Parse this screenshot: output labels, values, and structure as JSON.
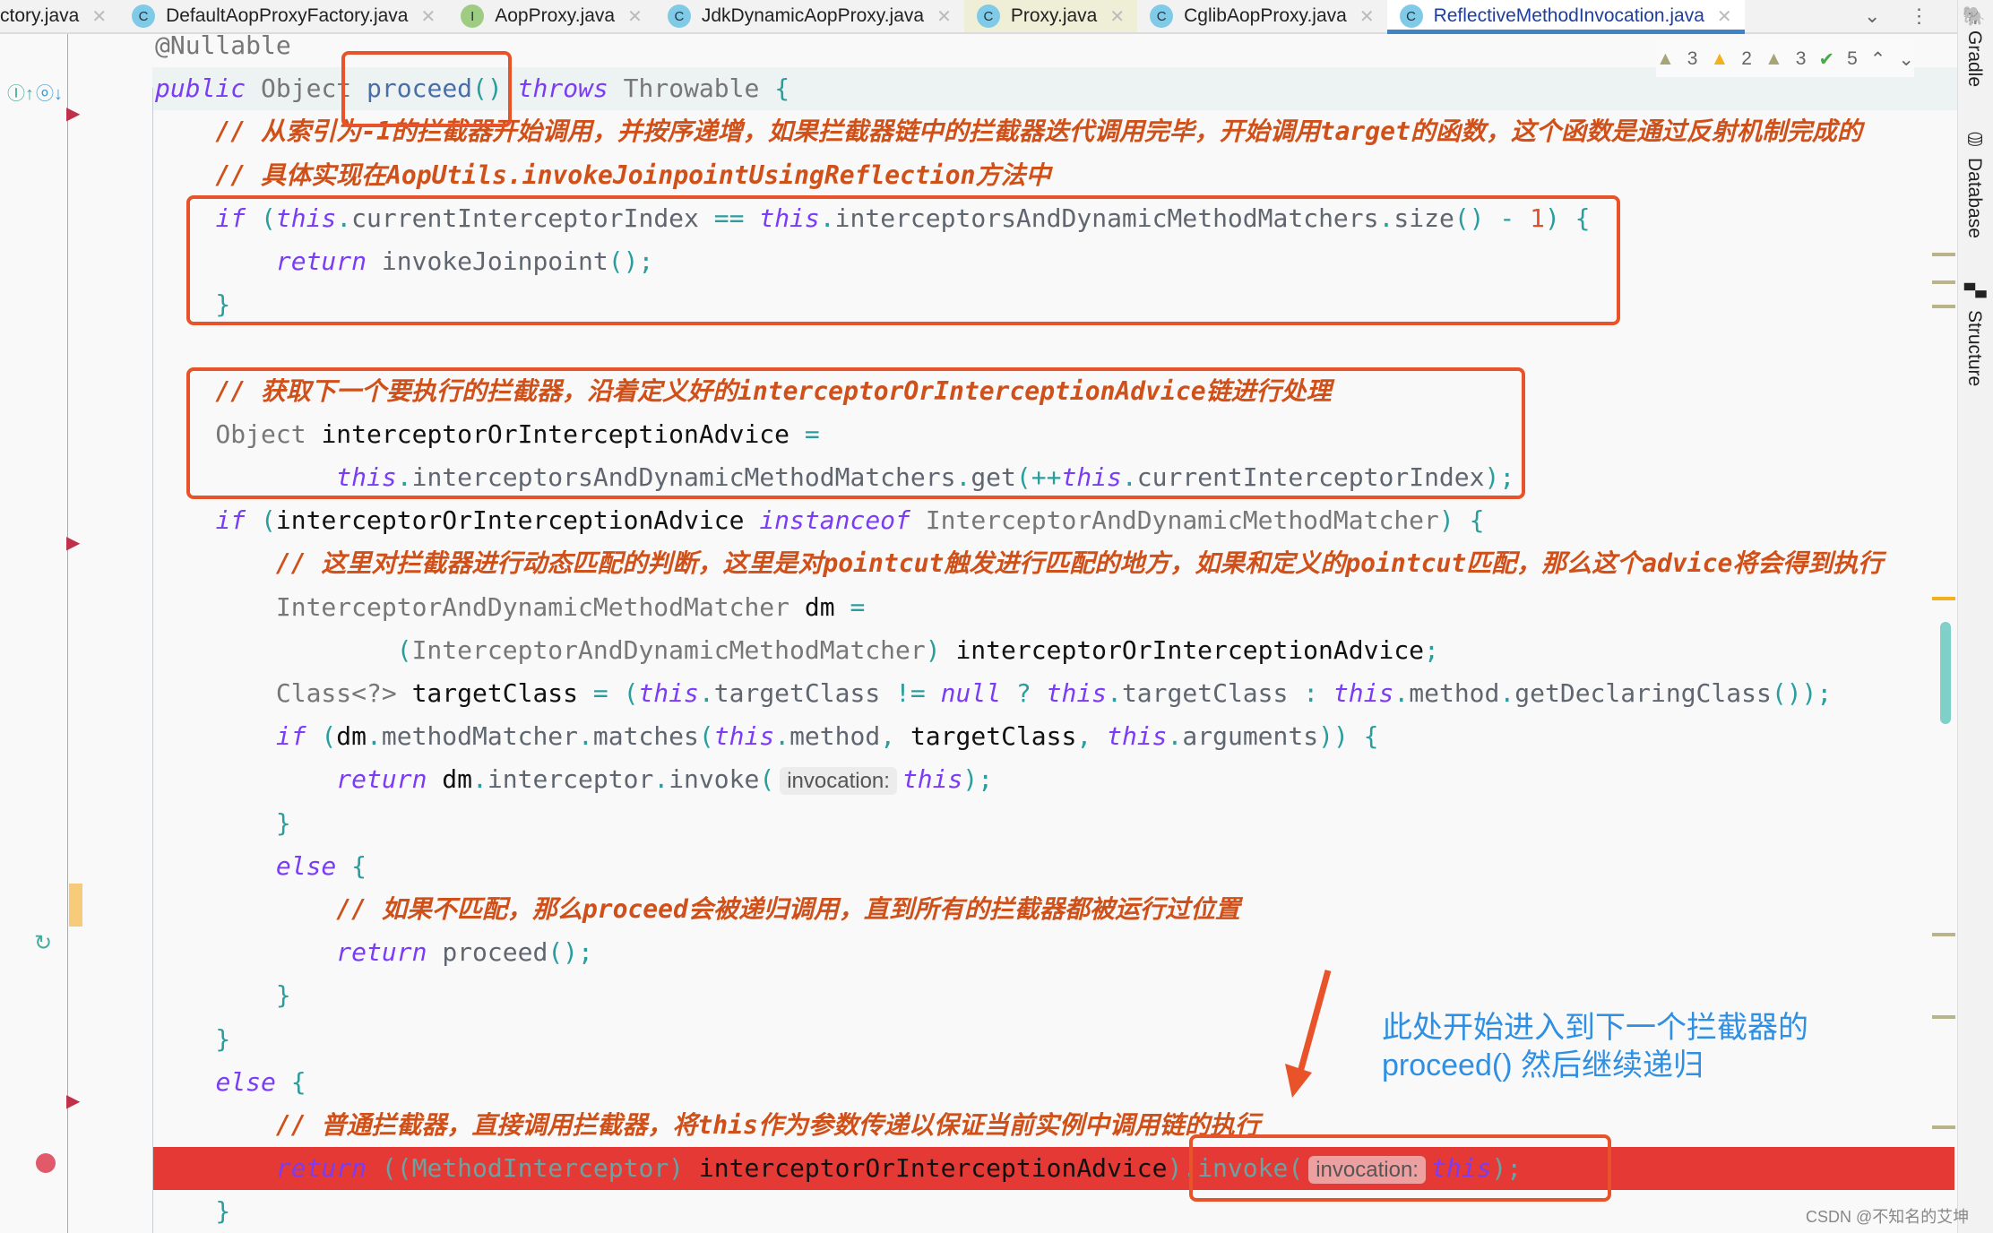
{
  "tabs": [
    {
      "label": "ctory.java",
      "icon": "class-icon",
      "type": "none"
    },
    {
      "label": "DefaultAopProxyFactory.java",
      "icon": "C",
      "type": "class"
    },
    {
      "label": "AopProxy.java",
      "icon": "I",
      "type": "interface"
    },
    {
      "label": "JdkDynamicAopProxy.java",
      "icon": "C",
      "type": "class"
    },
    {
      "label": "Proxy.java",
      "icon": "C",
      "type": "class",
      "highlight": true
    },
    {
      "label": "CglibAopProxy.java",
      "icon": "C",
      "type": "class"
    },
    {
      "label": "ReflectiveMethodInvocation.java",
      "icon": "C",
      "type": "class",
      "active": true
    }
  ],
  "toolbar": {
    "more_tabs": "⌄",
    "menu": "⋮"
  },
  "side_panels": [
    "Gradle",
    "Database",
    "Structure"
  ],
  "inspections": {
    "warn_a": "3",
    "warn_b": "2",
    "warn_c": "3",
    "ok": "5",
    "up": "⌃",
    "down": "⌄"
  },
  "code": [
    [
      [
        "a",
        "@Nullable"
      ]
    ],
    [
      [
        "k",
        "public"
      ],
      [
        "id",
        " "
      ],
      [
        "ty",
        "Object "
      ],
      [
        "m",
        "proceed"
      ],
      [
        "p",
        "()"
      ],
      [
        "id",
        " "
      ],
      [
        "k",
        "throws"
      ],
      [
        "ty",
        " Throwable "
      ],
      [
        "p",
        "{"
      ]
    ],
    [
      [
        "c",
        "    // 从索引为-1的拦截器开始调用，并按序递增，如果拦截器链中的拦截器迭代调用完毕，开始调用target的函数，这个函数是通过反射机制完成的"
      ]
    ],
    [
      [
        "c",
        "    // 具体实现在AopUtils.invokeJoinpointUsingReflection方法中"
      ]
    ],
    [
      [
        "id",
        "    "
      ],
      [
        "k",
        "if"
      ],
      [
        "p",
        " ("
      ],
      [
        "t",
        "this"
      ],
      [
        "p",
        "."
      ],
      [
        "f",
        "currentInterceptorIndex"
      ],
      [
        "p",
        " == "
      ],
      [
        "t",
        "this"
      ],
      [
        "p",
        "."
      ],
      [
        "f",
        "interceptorsAndDynamicMethodMatchers"
      ],
      [
        "p",
        "."
      ],
      [
        "f",
        "size"
      ],
      [
        "p",
        "() - "
      ],
      [
        "n",
        "1"
      ],
      [
        "p",
        ") {"
      ]
    ],
    [
      [
        "id",
        "        "
      ],
      [
        "k",
        "return"
      ],
      [
        "id",
        " "
      ],
      [
        "f",
        "invokeJoinpoint"
      ],
      [
        "p",
        "();"
      ]
    ],
    [
      [
        "p",
        "    }"
      ]
    ],
    [],
    [
      [
        "c",
        "    // 获取下一个要执行的拦截器，沿着定义好的interceptorOrInterceptionAdvice链进行处理"
      ]
    ],
    [
      [
        "ty",
        "    Object "
      ],
      [
        "id",
        "interceptorOrInterceptionAdvice"
      ],
      [
        "p",
        " ="
      ]
    ],
    [
      [
        "id",
        "            "
      ],
      [
        "t",
        "this"
      ],
      [
        "p",
        "."
      ],
      [
        "f",
        "interceptorsAndDynamicMethodMatchers"
      ],
      [
        "p",
        "."
      ],
      [
        "f",
        "get"
      ],
      [
        "p",
        "(++"
      ],
      [
        "t",
        "this"
      ],
      [
        "p",
        "."
      ],
      [
        "f",
        "currentInterceptorIndex"
      ],
      [
        "p",
        ");"
      ]
    ],
    [
      [
        "id",
        "    "
      ],
      [
        "k",
        "if"
      ],
      [
        "p",
        " ("
      ],
      [
        "id",
        "interceptorOrInterceptionAdvice "
      ],
      [
        "k",
        "instanceof"
      ],
      [
        "ty",
        " InterceptorAndDynamicMethodMatcher"
      ],
      [
        "p",
        ") {"
      ]
    ],
    [
      [
        "c",
        "        // 这里对拦截器进行动态匹配的判断，这里是对pointcut触发进行匹配的地方，如果和定义的pointcut匹配，那么这个advice将会得到执行"
      ]
    ],
    [
      [
        "ty",
        "        InterceptorAndDynamicMethodMatcher "
      ],
      [
        "id",
        "dm"
      ],
      [
        "p",
        " ="
      ]
    ],
    [
      [
        "p",
        "                ("
      ],
      [
        "ty",
        "InterceptorAndDynamicMethodMatcher"
      ],
      [
        "p",
        ") "
      ],
      [
        "id",
        "interceptorOrInterceptionAdvice"
      ],
      [
        "p",
        ";"
      ]
    ],
    [
      [
        "ty",
        "        Class<?> "
      ],
      [
        "id",
        "targetClass"
      ],
      [
        "p",
        " = ("
      ],
      [
        "t",
        "this"
      ],
      [
        "p",
        "."
      ],
      [
        "f",
        "targetClass"
      ],
      [
        "p",
        " != "
      ],
      [
        "k",
        "null"
      ],
      [
        "p",
        " ? "
      ],
      [
        "t",
        "this"
      ],
      [
        "p",
        "."
      ],
      [
        "f",
        "targetClass"
      ],
      [
        "p",
        " : "
      ],
      [
        "t",
        "this"
      ],
      [
        "p",
        "."
      ],
      [
        "f",
        "method"
      ],
      [
        "p",
        "."
      ],
      [
        "f",
        "getDeclaringClass"
      ],
      [
        "p",
        "());"
      ]
    ],
    [
      [
        "id",
        "        "
      ],
      [
        "k",
        "if"
      ],
      [
        "p",
        " ("
      ],
      [
        "id",
        "dm"
      ],
      [
        "p",
        "."
      ],
      [
        "f",
        "methodMatcher"
      ],
      [
        "p",
        "."
      ],
      [
        "f",
        "matches"
      ],
      [
        "p",
        "("
      ],
      [
        "t",
        "this"
      ],
      [
        "p",
        "."
      ],
      [
        "f",
        "method"
      ],
      [
        "p",
        ", "
      ],
      [
        "id",
        "targetClass"
      ],
      [
        "p",
        ", "
      ],
      [
        "t",
        "this"
      ],
      [
        "p",
        "."
      ],
      [
        "f",
        "arguments"
      ],
      [
        "p",
        ")) {"
      ]
    ],
    [
      [
        "id",
        "            "
      ],
      [
        "k",
        "return"
      ],
      [
        "id",
        " dm"
      ],
      [
        "p",
        "."
      ],
      [
        "f",
        "interceptor"
      ],
      [
        "p",
        "."
      ],
      [
        "f",
        "invoke"
      ],
      [
        "p",
        "("
      ],
      [
        "h",
        "invocation:"
      ],
      [
        "t",
        "this"
      ],
      [
        "p",
        ");"
      ]
    ],
    [
      [
        "p",
        "        }"
      ]
    ],
    [
      [
        "id",
        "        "
      ],
      [
        "k",
        "else"
      ],
      [
        "p",
        " {"
      ]
    ],
    [
      [
        "c",
        "            // 如果不匹配，那么proceed会被递归调用，直到所有的拦截器都被运行过位置"
      ]
    ],
    [
      [
        "id",
        "            "
      ],
      [
        "k",
        "return"
      ],
      [
        "id",
        " "
      ],
      [
        "f",
        "proceed"
      ],
      [
        "p",
        "();"
      ]
    ],
    [
      [
        "p",
        "        }"
      ]
    ],
    [
      [
        "p",
        "    }"
      ]
    ],
    [
      [
        "id",
        "    "
      ],
      [
        "k",
        "else"
      ],
      [
        "p",
        " {"
      ]
    ],
    [
      [
        "c",
        "        // 普通拦截器，直接调用拦截器，将this作为参数传递以保证当前实例中调用链的执行"
      ]
    ],
    [
      [
        "id",
        "        "
      ],
      [
        "k",
        "return"
      ],
      [
        "p",
        " (("
      ],
      [
        "ty",
        "MethodInterceptor"
      ],
      [
        "p",
        ") "
      ],
      [
        "id",
        "interceptorOrInterceptionAdvice"
      ],
      [
        "p",
        ")."
      ],
      [
        "m",
        "invoke"
      ],
      [
        "p",
        "("
      ],
      [
        "h",
        "invocation:"
      ],
      [
        "t",
        "this"
      ],
      [
        "p",
        ");"
      ]
    ],
    [
      [
        "p",
        "    }"
      ]
    ]
  ],
  "annotation": {
    "line1": "此处开始进入到下一个拦截器的",
    "line2": "proceed() 然后继续递归",
    "color": "#2f8fe2"
  },
  "highlight_color": "#e9532a",
  "breakpoint_line_color": "#e53935",
  "watermark": "CSDN @不知名的艾坤"
}
